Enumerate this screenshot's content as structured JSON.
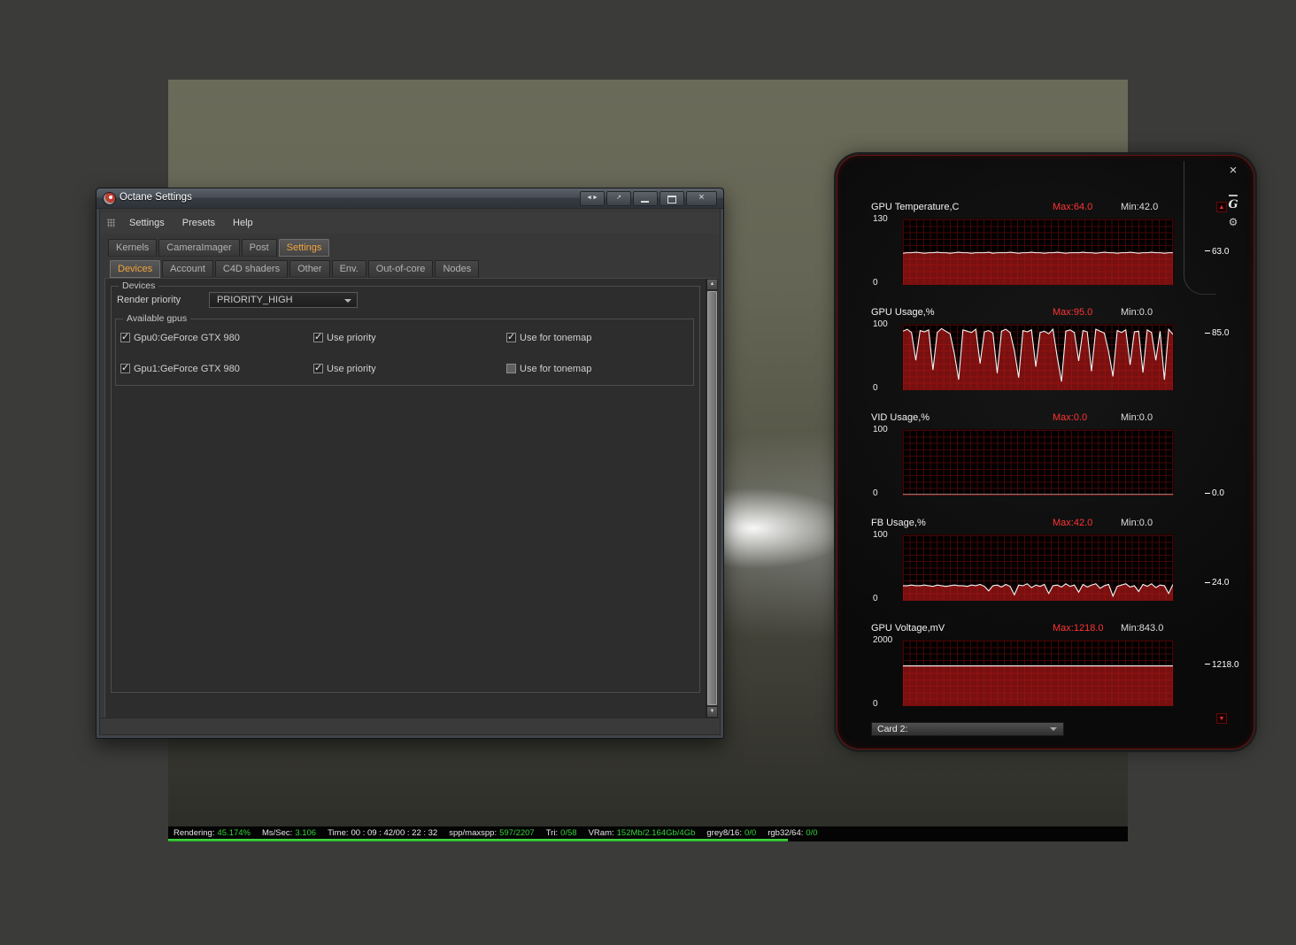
{
  "app": {
    "title_bar": {
      "title": "Octane Settings"
    },
    "menu": {
      "items": [
        "Settings",
        "Presets",
        "Help"
      ]
    },
    "tabs_top": [
      {
        "label": "Kernels",
        "active": false
      },
      {
        "label": "CameraImager",
        "active": false
      },
      {
        "label": "Post",
        "active": false
      },
      {
        "label": "Settings",
        "active": true
      }
    ],
    "tabs_sub": [
      {
        "label": "Devices",
        "active": true
      },
      {
        "label": "Account",
        "active": false
      },
      {
        "label": "C4D shaders",
        "active": false
      },
      {
        "label": "Other",
        "active": false
      },
      {
        "label": "Env.",
        "active": false
      },
      {
        "label": "Out-of-core",
        "active": false
      },
      {
        "label": "Nodes",
        "active": false
      }
    ],
    "devices": {
      "group_label": "Devices",
      "render_priority_label": "Render priority",
      "render_priority_value": "PRIORITY_HIGH",
      "gpus_group_label": "Available gpus",
      "use_priority_label": "Use priority",
      "use_tonemap_label": "Use for tonemap",
      "gpus": [
        {
          "name": "Gpu0:GeForce GTX 980",
          "enabled": true,
          "use_priority": true,
          "use_for_tonemap": true
        },
        {
          "name": "Gpu1:GeForce GTX 980",
          "enabled": true,
          "use_priority": true,
          "use_for_tonemap": false
        }
      ]
    }
  },
  "monitor": {
    "card_selector_label": "Card 2:"
  },
  "statusbar": {
    "items": [
      {
        "label": "Rendering:",
        "value": "45.174%",
        "value_color": "green"
      },
      {
        "label": "Ms/Sec:",
        "value": "3.106",
        "value_color": "green"
      },
      {
        "label": "Time:",
        "value": "00 : 09 : 42/00 : 22 : 32",
        "value_color": "white"
      },
      {
        "label": "spp/maxspp:",
        "value": "597/2207",
        "value_color": "green"
      },
      {
        "label": "Tri:",
        "value": "0/58",
        "value_color": "green"
      },
      {
        "label": "VRam:",
        "value": "152Mb/2.164Gb/4Gb",
        "value_color": "green"
      },
      {
        "label": "grey8/16:",
        "value": "0/0",
        "value_color": "green"
      },
      {
        "label": "rgb32/64:",
        "value": "0/0",
        "value_color": "green"
      }
    ],
    "progress_percent": 45.174
  },
  "chart_data": [
    {
      "type": "area",
      "title": "GPU Temperature,C",
      "max_label": "Max:64.0",
      "min_label": "Min:42.0",
      "y_top_label": "130",
      "y_bottom_label": "0",
      "ymax": 130,
      "current": 63.0,
      "current_label": "63.0",
      "values": [
        62,
        63,
        63,
        64,
        63,
        62,
        63,
        63,
        64,
        63,
        63,
        62,
        63,
        64,
        63,
        63,
        62,
        63,
        63,
        63,
        64,
        62,
        63,
        63,
        63,
        64,
        63,
        62,
        63,
        63,
        64,
        63,
        63,
        62,
        63,
        63,
        64,
        63,
        62,
        63,
        63,
        63,
        64,
        63,
        63,
        62,
        63,
        64,
        63,
        63,
        62,
        63,
        63,
        64,
        63,
        62,
        63,
        63,
        64,
        63,
        63,
        62,
        63,
        63
      ]
    },
    {
      "type": "area",
      "title": "GPU Usage,%",
      "max_label": "Max:95.0",
      "min_label": "Min:0.0",
      "y_top_label": "100",
      "y_bottom_label": "0",
      "ymax": 100,
      "current": 85.0,
      "current_label": "85.0",
      "values": [
        90,
        93,
        88,
        45,
        91,
        89,
        92,
        30,
        88,
        94,
        90,
        86,
        55,
        15,
        92,
        90,
        88,
        93,
        40,
        89,
        91,
        87,
        25,
        90,
        93,
        88,
        60,
        18,
        91,
        89,
        92,
        35,
        88,
        90,
        86,
        93,
        50,
        12,
        90,
        92,
        88,
        44,
        91,
        89,
        28,
        93,
        90,
        87,
        58,
        20,
        91,
        88,
        92,
        38,
        89,
        90,
        26,
        92,
        88,
        45,
        90,
        15,
        93,
        85
      ]
    },
    {
      "type": "area",
      "title": "VID Usage,%",
      "max_label": "Max:0.0",
      "min_label": "Min:0.0",
      "y_top_label": "100",
      "y_bottom_label": "0",
      "ymax": 100,
      "current": 0.0,
      "current_label": "0.0",
      "values": [
        0,
        0,
        0,
        0,
        0,
        0,
        0,
        0,
        0,
        0,
        0,
        0,
        0,
        0,
        0,
        0,
        0,
        0,
        0,
        0,
        0,
        0,
        0,
        0,
        0,
        0,
        0,
        0,
        0,
        0,
        0,
        0,
        0,
        0,
        0,
        0,
        0,
        0,
        0,
        0,
        0,
        0,
        0,
        0,
        0,
        0,
        0,
        0,
        0,
        0,
        0,
        0,
        0,
        0,
        0,
        0,
        0,
        0,
        0,
        0,
        0,
        0,
        0,
        0
      ]
    },
    {
      "type": "area",
      "title": "FB Usage,%",
      "max_label": "Max:42.0",
      "min_label": "Min:0.0",
      "y_top_label": "100",
      "y_bottom_label": "0",
      "ymax": 100,
      "current": 24.0,
      "current_label": "24.0",
      "values": [
        22,
        22,
        23,
        22,
        22,
        23,
        22,
        21,
        23,
        22,
        21,
        22,
        23,
        22,
        22,
        21,
        23,
        22,
        24,
        21,
        14,
        22,
        23,
        20,
        24,
        21,
        8,
        23,
        22,
        25,
        19,
        23,
        21,
        24,
        10,
        22,
        23,
        20,
        25,
        21,
        23,
        12,
        24,
        20,
        23,
        25,
        18,
        22,
        24,
        6,
        21,
        23,
        25,
        20,
        22,
        13,
        24,
        21,
        25,
        19,
        23,
        22,
        10,
        24
      ]
    },
    {
      "type": "area",
      "title": "GPU Voltage,mV",
      "max_label": "Max:1218.0",
      "min_label": "Min:843.0",
      "y_top_label": "2000",
      "y_bottom_label": "0",
      "ymax": 2000,
      "current": 1218.0,
      "current_label": "1218.0",
      "values": [
        1218,
        1218,
        1218,
        1218,
        1218,
        1218,
        1218,
        1218,
        1218,
        1218,
        1218,
        1218,
        1218,
        1218,
        1218,
        1218,
        1218,
        1218,
        1218,
        1218,
        1218,
        1218,
        1218,
        1218,
        1218,
        1218,
        1218,
        1218,
        1218,
        1218,
        1218,
        1218,
        1218,
        1218,
        1218,
        1218,
        1218,
        1218,
        1218,
        1218,
        1218,
        1218,
        1218,
        1218,
        1218,
        1218,
        1218,
        1218,
        1218,
        1218,
        1218,
        1218,
        1218,
        1218,
        1218,
        1218,
        1218,
        1218,
        1218,
        1218,
        1218,
        1218,
        1218,
        1218
      ]
    }
  ],
  "colors": {
    "accent_orange": "#f2a33c",
    "chart_red": "#c01a1a",
    "status_green": "#35d23a"
  }
}
